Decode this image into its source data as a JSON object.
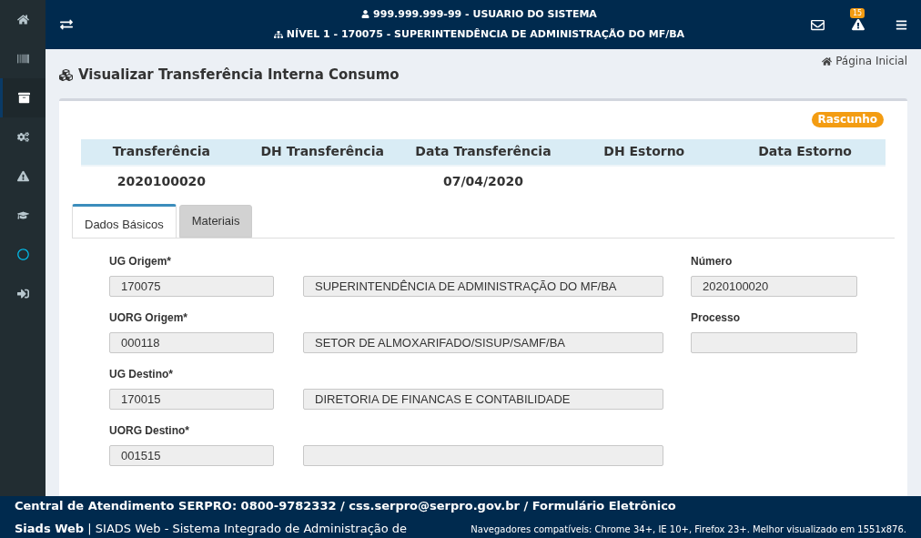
{
  "sidebar": {
    "items": [
      {
        "kind": "home",
        "selected": false
      },
      {
        "kind": "barcode",
        "selected": false
      },
      {
        "kind": "archive",
        "selected": true
      },
      {
        "kind": "cogs",
        "selected": false
      },
      {
        "kind": "warning",
        "selected": false
      },
      {
        "kind": "graduation",
        "selected": false
      },
      {
        "kind": "circle",
        "selected": false
      },
      {
        "kind": "signin",
        "selected": false
      }
    ]
  },
  "header": {
    "user": "999.999.999-99 - USUARIO DO SISTEMA",
    "level": "NÍVEL 1 - 170075 - SUPERINTENDÊNCIA DE ADMINISTRAÇÃO DO MF/BA",
    "alert_count": "15"
  },
  "page": {
    "title": "Visualizar Transferência Interna Consumo",
    "breadcrumb": "Página Inicial"
  },
  "status_badge": "Rascunho",
  "summary": {
    "columns": [
      {
        "header": "Transferência",
        "value": "2020100020"
      },
      {
        "header": "DH Transferência"
      },
      {
        "header": "Data Transferência",
        "value": "07/04/2020"
      },
      {
        "header": "DH Estorno"
      },
      {
        "header": "Data Estorno"
      }
    ]
  },
  "tabs": [
    {
      "label": "Dados Básicos",
      "selected": true
    },
    {
      "label": "Materiais",
      "selected": false
    }
  ],
  "form": {
    "rows": [
      {
        "label": "UG Origem*",
        "code": "170075",
        "description": "SUPERINTENDÊNCIA DE ADMINISTRAÇÃO DO MF/BA",
        "side_label": "Número",
        "side_value": "2020100020"
      },
      {
        "label": "UORG Origem*",
        "code": "000118",
        "description": "SETOR DE ALMOXARIFADO/SISUP/SAMF/BA",
        "side_label": "Processo",
        "side_value": ""
      },
      {
        "label": "UG Destino*",
        "code": "170015",
        "description": "DIRETORIA DE FINANCAS E CONTABILIDADE"
      },
      {
        "label": "UORG Destino*",
        "code": "001515",
        "description": ""
      }
    ]
  },
  "footer": {
    "contact": "Central de Atendimento SERPRO: 0800-9782332 / css.serpro@serpro.gov.br / Formulário Eletrônico",
    "system": "**Siads Web** | SIADS Web - Sistema Integrado de Administração de",
    "browsers": "Navegadores compatíveis: Chrome 34+, IE 10+, Firefox 23+. Melhor visualizado em 1551x876."
  }
}
